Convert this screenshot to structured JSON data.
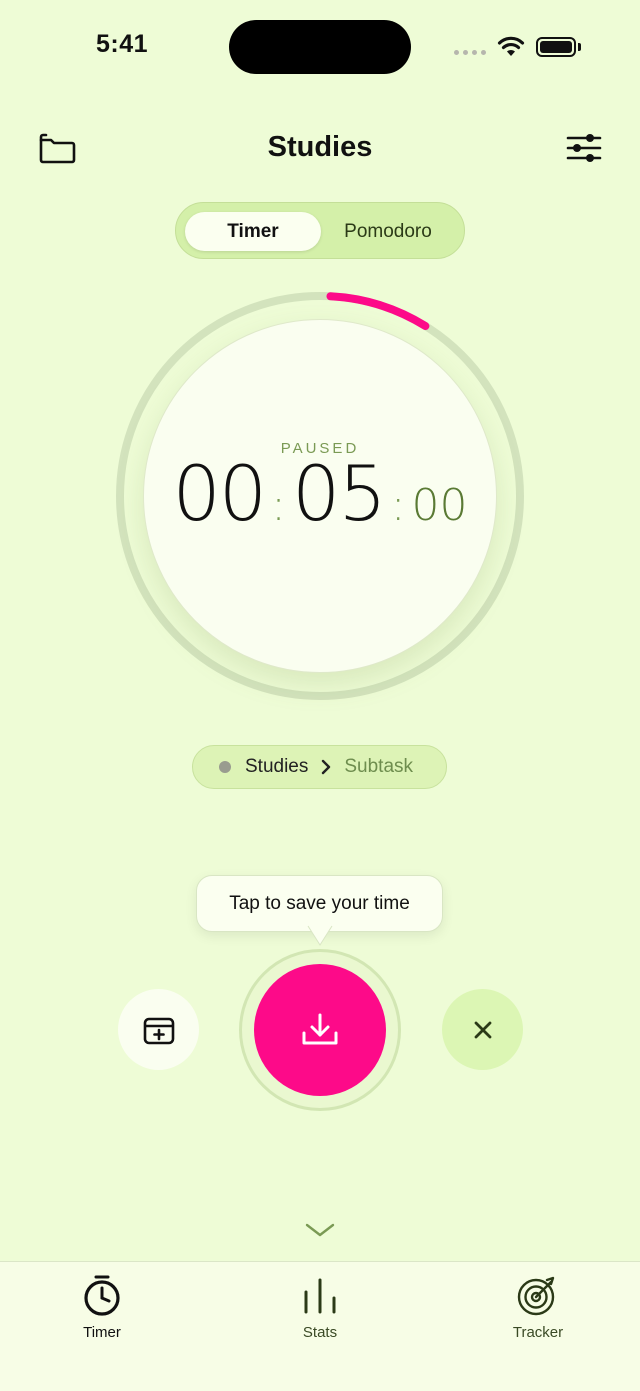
{
  "status_bar": {
    "time": "5:41"
  },
  "header": {
    "title": "Studies"
  },
  "mode_switch": {
    "options": [
      "Timer",
      "Pomodoro"
    ],
    "selected": "Timer"
  },
  "timer": {
    "state": "PAUSED",
    "hours": "00",
    "minutes": "05",
    "seconds": "00",
    "progress": 0.08,
    "accent_color": "#fd0a89"
  },
  "task": {
    "project": "Studies",
    "subtask": "Subtask"
  },
  "tooltip": {
    "text": "Tap to save your time"
  },
  "tabs": [
    {
      "label": "Timer",
      "icon": "stopwatch-icon",
      "active": true
    },
    {
      "label": "Stats",
      "icon": "bar-chart-icon",
      "active": false
    },
    {
      "label": "Tracker",
      "icon": "target-icon",
      "active": false
    }
  ],
  "colors": {
    "background": "#eefcd6",
    "accent": "#fd0a89",
    "secondary_text": "#7a9a54"
  }
}
